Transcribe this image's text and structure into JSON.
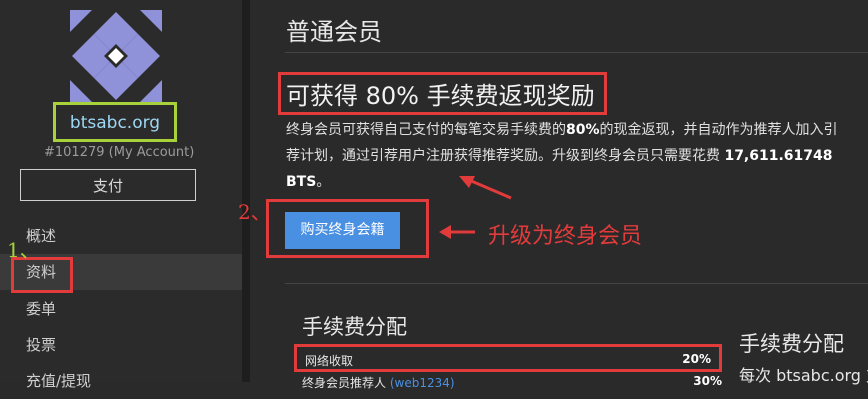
{
  "sidebar": {
    "account_name": "btsabc.org",
    "account_id": "#101279 (My Account)",
    "pay_button": "支付",
    "nav": [
      {
        "label": "概述"
      },
      {
        "label": "资料"
      },
      {
        "label": "委单"
      },
      {
        "label": "投票"
      },
      {
        "label": "充值/提现"
      }
    ]
  },
  "annotations": {
    "step1": "1、",
    "step2": "2、",
    "upgrade_note": "升级为终身会员"
  },
  "main": {
    "page_title": "普通会员",
    "promo_title": "可获得 80% 手续费返现奖励",
    "promo_text_1": "终身会员可获得自己支付的每笔交易手续费的",
    "promo_text_bold": "80%",
    "promo_text_2": "的现金返现，并自动作为推荐人加入引荐计划，通过引荐用户注册获得推荐奖励。升级到终身会员只需要花费 ",
    "promo_amount": "17,611.61748 BTS",
    "promo_text_end": "。",
    "buy_button": "购买终身会籍",
    "fee_title": "手续费分配",
    "fee_rows": [
      {
        "label": "网络收取",
        "value": "20%"
      },
      {
        "label": "终身会员推荐人",
        "link": "(web1234)",
        "value": "30%"
      }
    ],
    "side_title": "手续费分配",
    "side_text": "每次 btsabc.org 支"
  },
  "colors": {
    "accent": "#4a90e2",
    "annotation_red": "#e23b3b",
    "annotation_green": "#a8d23a",
    "link": "#9dd7f3"
  }
}
